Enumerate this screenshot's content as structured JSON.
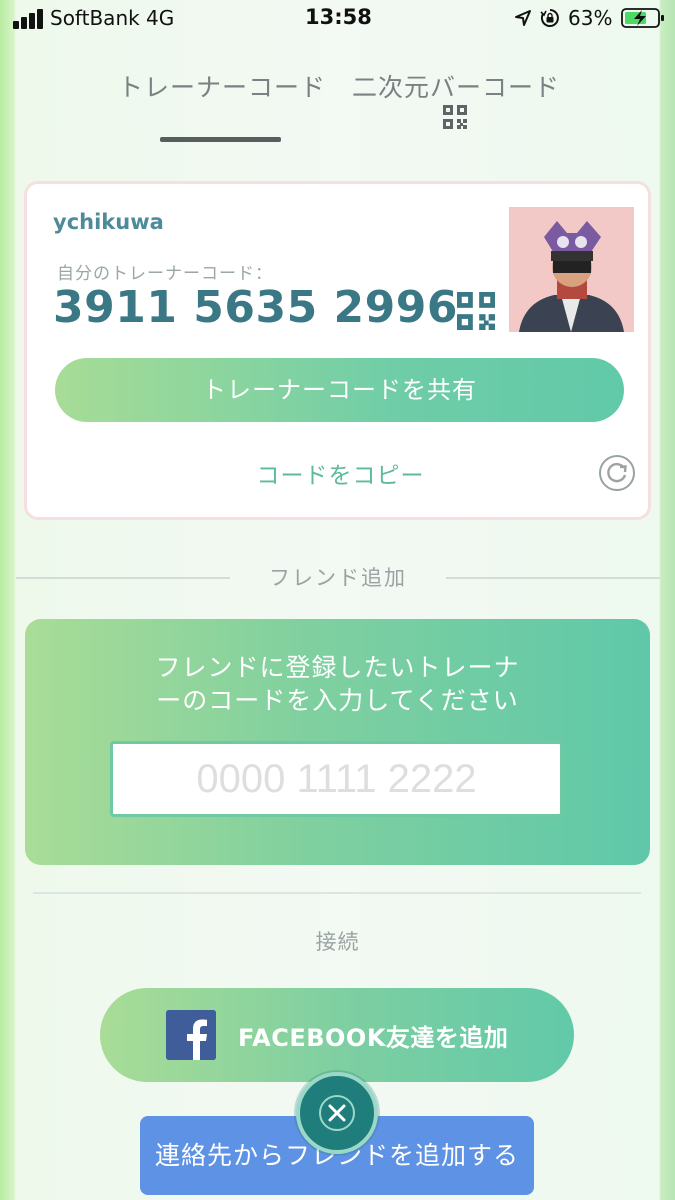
{
  "status_bar": {
    "carrier": "SoftBank  4G",
    "time": "13:58",
    "battery": "63%",
    "icons": [
      "signal-icon",
      "location-icon",
      "rotation-lock-icon",
      "battery-charging-icon"
    ]
  },
  "tabs": [
    {
      "label": "トレーナーコード",
      "selected": true
    },
    {
      "label": "二次元バーコード",
      "selected": false,
      "icon": "qr-code-icon"
    }
  ],
  "trainer_card": {
    "name": "ychikuwa",
    "code_label": "自分のトレーナーコード：",
    "code": "3911 5635 2996",
    "share_label": "トレーナーコードを共有",
    "copy_label": "コードをコピー",
    "icons": [
      "qr-code-icon",
      "refresh-icon",
      "avatar"
    ]
  },
  "friend_add": {
    "section_title": "フレンド追加",
    "instruction_line1": "フレンドに登録したいトレーナ",
    "instruction_line2": "ーのコードを入力してください",
    "input_placeholder": "0000 1111 2222",
    "input_value": ""
  },
  "connect": {
    "section_title": "接続",
    "facebook_label": "FACEBOOK友達を追加",
    "contacts_label": "連絡先からフレンドを追加する"
  },
  "colors": {
    "accent_green": "#61c9a9",
    "code_teal": "#3b7886",
    "contacts_blue": "#5e92e4",
    "close_button": "#1f7e7b",
    "facebook_blue": "#3f5d98"
  }
}
